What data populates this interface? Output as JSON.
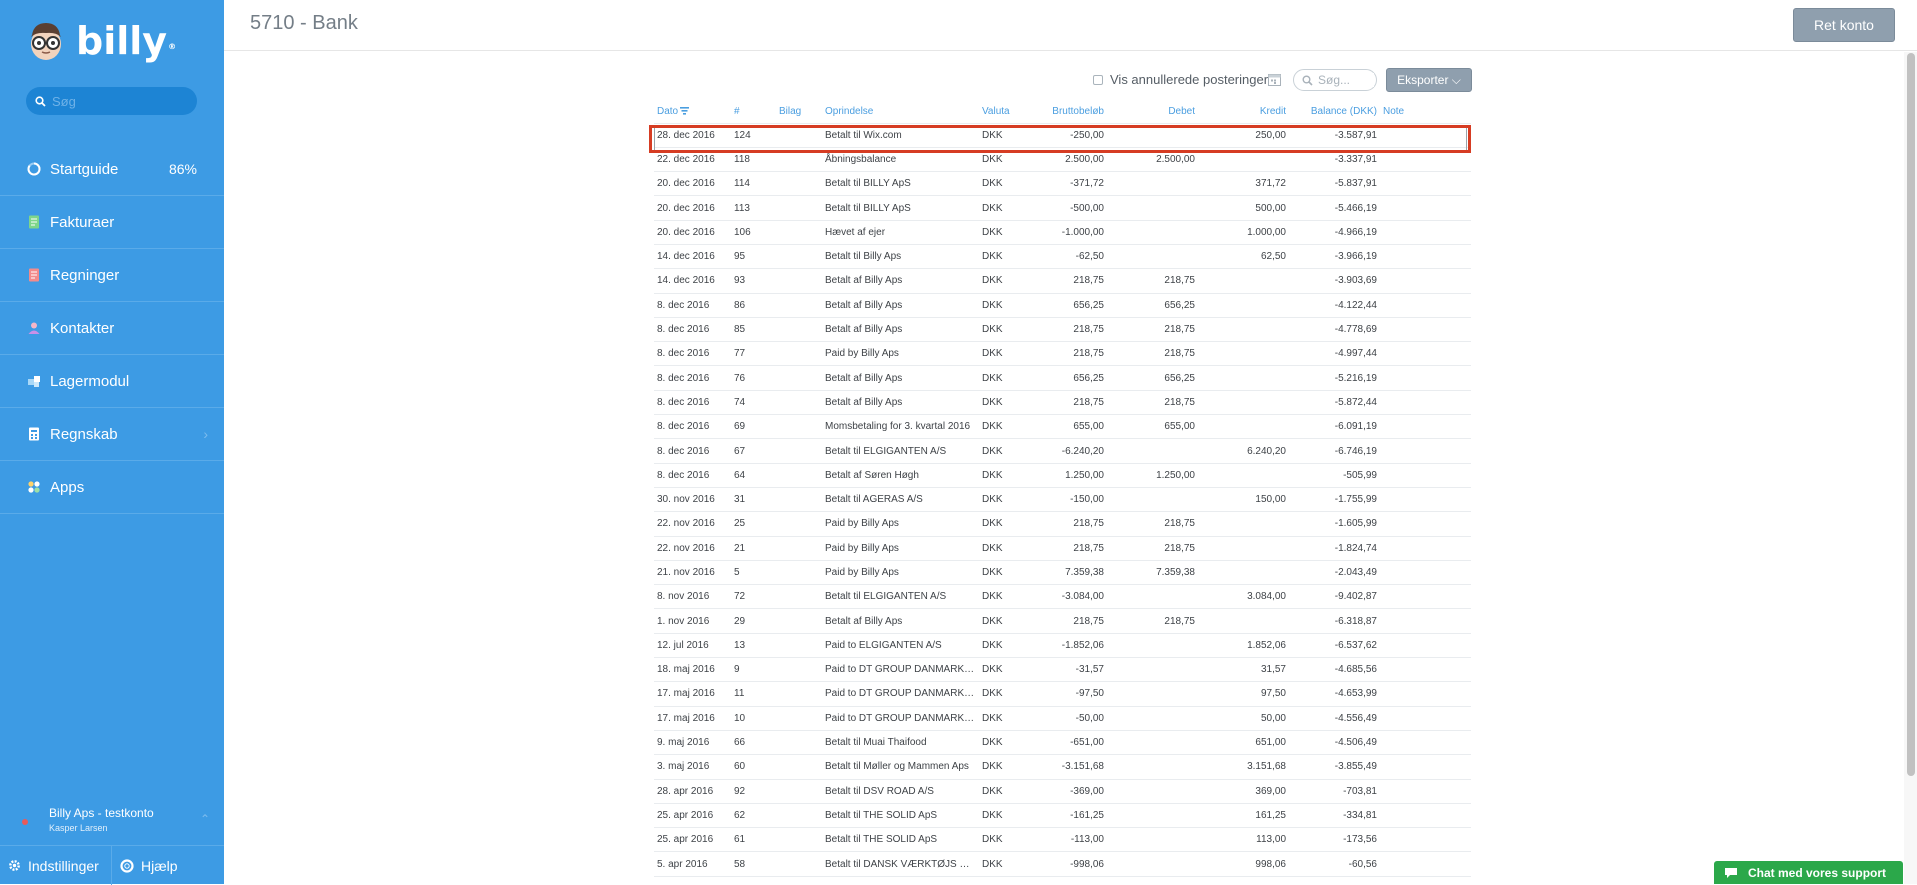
{
  "sidebar": {
    "logo_text": "billy",
    "logo_reg": "®",
    "search_placeholder": "Søg",
    "items": [
      {
        "label": "Startguide",
        "icon": "progress-ring-icon",
        "percent": "86%"
      },
      {
        "label": "Fakturaer",
        "icon": "invoice-icon"
      },
      {
        "label": "Regninger",
        "icon": "bill-icon"
      },
      {
        "label": "Kontakter",
        "icon": "contact-icon"
      },
      {
        "label": "Lagermodul",
        "icon": "inventory-icon"
      },
      {
        "label": "Regnskab",
        "icon": "accounting-icon",
        "chevron": "›"
      },
      {
        "label": "Apps",
        "icon": "apps-icon"
      }
    ],
    "account": {
      "company": "Billy Aps - testkonto",
      "user": "Kasper Larsen",
      "chevron": "⌃"
    },
    "bottom": {
      "settings_label": "Indstillinger",
      "help_label": "Hjælp"
    }
  },
  "header": {
    "title": "5710 - Bank",
    "edit_button": "Ret konto"
  },
  "toolbar": {
    "show_cancelled_label": "Vis annullerede posteringer",
    "search_placeholder": "Søg...",
    "export_label": "Eksporter",
    "export_chevron": "⌵"
  },
  "table": {
    "columns": [
      "Dato",
      "#",
      "Bilag",
      "Oprindelse",
      "Valuta",
      "Bruttobeløb",
      "Debet",
      "Kredit",
      "Balance (DKK)",
      "Note"
    ],
    "rows": [
      [
        "28. dec 2016",
        "124",
        "",
        "Betalt til Wix.com",
        "DKK",
        "-250,00",
        "",
        "250,00",
        "-3.587,91",
        ""
      ],
      [
        "22. dec 2016",
        "118",
        "",
        "Åbningsbalance",
        "DKK",
        "2.500,00",
        "2.500,00",
        "",
        "-3.337,91",
        ""
      ],
      [
        "20. dec 2016",
        "114",
        "",
        "Betalt til BILLY ApS",
        "DKK",
        "-371,72",
        "",
        "371,72",
        "-5.837,91",
        ""
      ],
      [
        "20. dec 2016",
        "113",
        "",
        "Betalt til BILLY ApS",
        "DKK",
        "-500,00",
        "",
        "500,00",
        "-5.466,19",
        ""
      ],
      [
        "20. dec 2016",
        "106",
        "",
        "Hævet af ejer",
        "DKK",
        "-1.000,00",
        "",
        "1.000,00",
        "-4.966,19",
        ""
      ],
      [
        "14. dec 2016",
        "95",
        "",
        "Betalt til Billy Aps",
        "DKK",
        "-62,50",
        "",
        "62,50",
        "-3.966,19",
        ""
      ],
      [
        "14. dec 2016",
        "93",
        "",
        "Betalt af Billy Aps",
        "DKK",
        "218,75",
        "218,75",
        "",
        "-3.903,69",
        ""
      ],
      [
        "8. dec 2016",
        "86",
        "",
        "Betalt af Billy Aps",
        "DKK",
        "656,25",
        "656,25",
        "",
        "-4.122,44",
        ""
      ],
      [
        "8. dec 2016",
        "85",
        "",
        "Betalt af Billy Aps",
        "DKK",
        "218,75",
        "218,75",
        "",
        "-4.778,69",
        ""
      ],
      [
        "8. dec 2016",
        "77",
        "",
        "Paid by Billy Aps",
        "DKK",
        "218,75",
        "218,75",
        "",
        "-4.997,44",
        ""
      ],
      [
        "8. dec 2016",
        "76",
        "",
        "Betalt af Billy Aps",
        "DKK",
        "656,25",
        "656,25",
        "",
        "-5.216,19",
        ""
      ],
      [
        "8. dec 2016",
        "74",
        "",
        "Betalt af Billy Aps",
        "DKK",
        "218,75",
        "218,75",
        "",
        "-5.872,44",
        ""
      ],
      [
        "8. dec 2016",
        "69",
        "",
        "Momsbetaling for 3. kvartal 2016",
        "DKK",
        "655,00",
        "655,00",
        "",
        "-6.091,19",
        ""
      ],
      [
        "8. dec 2016",
        "67",
        "",
        "Betalt til ELGIGANTEN A/S",
        "DKK",
        "-6.240,20",
        "",
        "6.240,20",
        "-6.746,19",
        ""
      ],
      [
        "8. dec 2016",
        "64",
        "",
        "Betalt af Søren Høgh",
        "DKK",
        "1.250,00",
        "1.250,00",
        "",
        "-505,99",
        ""
      ],
      [
        "30. nov 2016",
        "31",
        "",
        "Betalt til AGERAS A/S",
        "DKK",
        "-150,00",
        "",
        "150,00",
        "-1.755,99",
        ""
      ],
      [
        "22. nov 2016",
        "25",
        "",
        "Paid by Billy Aps",
        "DKK",
        "218,75",
        "218,75",
        "",
        "-1.605,99",
        ""
      ],
      [
        "22. nov 2016",
        "21",
        "",
        "Paid by Billy Aps",
        "DKK",
        "218,75",
        "218,75",
        "",
        "-1.824,74",
        ""
      ],
      [
        "21. nov 2016",
        "5",
        "",
        "Paid by Billy Aps",
        "DKK",
        "7.359,38",
        "7.359,38",
        "",
        "-2.043,49",
        ""
      ],
      [
        "8. nov 2016",
        "72",
        "",
        "Betalt til ELGIGANTEN A/S",
        "DKK",
        "-3.084,00",
        "",
        "3.084,00",
        "-9.402,87",
        ""
      ],
      [
        "1. nov 2016",
        "29",
        "",
        "Betalt af Billy Aps",
        "DKK",
        "218,75",
        "218,75",
        "",
        "-6.318,87",
        ""
      ],
      [
        "12. jul 2016",
        "13",
        "",
        "Paid to ELGIGANTEN A/S",
        "DKK",
        "-1.852,06",
        "",
        "1.852,06",
        "-6.537,62",
        ""
      ],
      [
        "18. maj 2016",
        "9",
        "",
        "Paid to DT GROUP DANMARK A/S",
        "DKK",
        "-31,57",
        "",
        "31,57",
        "-4.685,56",
        ""
      ],
      [
        "17. maj 2016",
        "11",
        "",
        "Paid to DT GROUP DANMARK A/S",
        "DKK",
        "-97,50",
        "",
        "97,50",
        "-4.653,99",
        ""
      ],
      [
        "17. maj 2016",
        "10",
        "",
        "Paid to DT GROUP DANMARK A/S",
        "DKK",
        "-50,00",
        "",
        "50,00",
        "-4.556,49",
        ""
      ],
      [
        "9. maj 2016",
        "66",
        "",
        "Betalt til Muai Thaifood",
        "DKK",
        "-651,00",
        "",
        "651,00",
        "-4.506,49",
        ""
      ],
      [
        "3. maj 2016",
        "60",
        "",
        "Betalt til Møller og Mammen Aps",
        "DKK",
        "-3.151,68",
        "",
        "3.151,68",
        "-3.855,49",
        ""
      ],
      [
        "28. apr 2016",
        "92",
        "",
        "Betalt til DSV ROAD A/S",
        "DKK",
        "-369,00",
        "",
        "369,00",
        "-703,81",
        ""
      ],
      [
        "25. apr 2016",
        "62",
        "",
        "Betalt til THE SOLID ApS",
        "DKK",
        "-161,25",
        "",
        "161,25",
        "-334,81",
        ""
      ],
      [
        "25. apr 2016",
        "61",
        "",
        "Betalt til THE SOLID ApS",
        "DKK",
        "-113,00",
        "",
        "113,00",
        "-173,56",
        ""
      ],
      [
        "5. apr 2016",
        "58",
        "",
        "Betalt til DANSK VÆRKTØJS SA...",
        "DKK",
        "-998,06",
        "",
        "998,06",
        "-60,56",
        ""
      ]
    ]
  },
  "chat": {
    "label": "Chat med vores support"
  },
  "colors": {
    "sidebar": "#3d9be4",
    "accent": "#4a9ee0",
    "highlight": "#d63c23",
    "chat": "#2ba84a",
    "button": "#8f9fae"
  }
}
